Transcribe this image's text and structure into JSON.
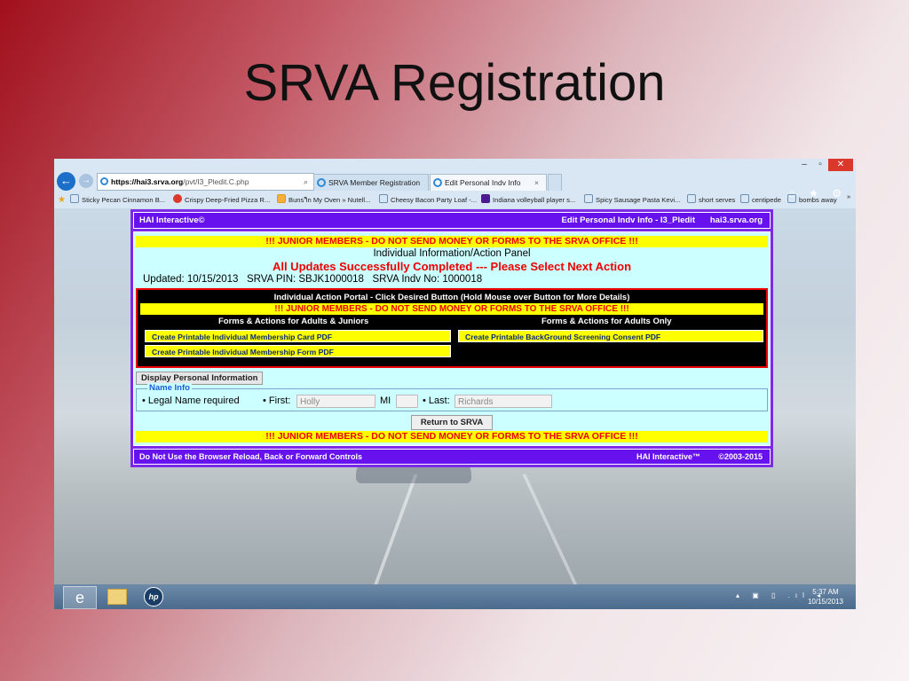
{
  "slide": {
    "title": "SRVA Registration"
  },
  "browser": {
    "url_scheme": "https://",
    "url_domain": "hai3.srva.org",
    "url_path": "/pvt/I3_Pledit.C.php",
    "address_tools": "⌕ ▾ 🔒 🗎 C",
    "tabs": [
      {
        "label": "SRVA Member Registration",
        "active": false
      },
      {
        "label": "Edit Personal Indv Info",
        "active": true
      }
    ],
    "tab_close": "×",
    "window_controls": [
      "–",
      "▫",
      "✕"
    ],
    "right_tools": "⌂ ★ ⚙",
    "favorites": [
      "Sticky Pecan Cinnamon B...",
      "Crispy Deep-Fried Pizza R...",
      "Buns In My Oven » Nutell...",
      "Cheesy Bacon Party Loaf -...",
      "Indiana volleyball player s...",
      "Spicy Sausage Pasta  Kevi...",
      "short serves",
      "centipede",
      "bombs away"
    ],
    "favorites_more": "»"
  },
  "page": {
    "header_left": "HAI Interactive©",
    "header_right1": "Edit Personal Indv Info - I3_Pledit",
    "header_right2": "hai3.srva.org",
    "warning": "!!! JUNIOR MEMBERS - DO NOT SEND MONEY OR FORMS TO THE SRVA OFFICE !!!",
    "panel_title": "Individual Information/Action Panel",
    "success": "All Updates Successfully Completed --- Please Select Next Action",
    "updated": "Updated: 10/15/2013   SRVA PIN: SBJK1000018   SRVA Indv No: 1000018",
    "portal_title": "Individual Action Portal - Click Desired Button (Hold Mouse over Button for More Details)",
    "col_left_title": "Forms & Actions for Adults & Juniors",
    "col_right_title": "Forms & Actions for Adults Only",
    "btn_card": "Create Printable Individual Membership Card PDF",
    "btn_form": "Create Printable Individual Membership Form PDF",
    "btn_bg": "Create Printable BackGround Screening Consent PDF",
    "display_btn": "Display Personal Information",
    "name_legend": "Name Info",
    "legal_label": "• Legal Name required",
    "first_label": "• First:",
    "first_value": "Holly",
    "mi_label": "MI",
    "mi_value": "",
    "last_label": "• Last:",
    "last_value": "Richards",
    "return_btn": "Return to SRVA",
    "footer_left": "Do Not Use the Browser Reload, Back or Forward Controls",
    "footer_right1": "HAI Interactive™",
    "footer_right2": "©2003-2015"
  },
  "taskbar": {
    "ie_glyph": "e",
    "hp_label": "hp",
    "tray": "▴ ▣ ▯ .ıl ◂",
    "time": "5:37 AM",
    "date": "10/15/2013"
  }
}
